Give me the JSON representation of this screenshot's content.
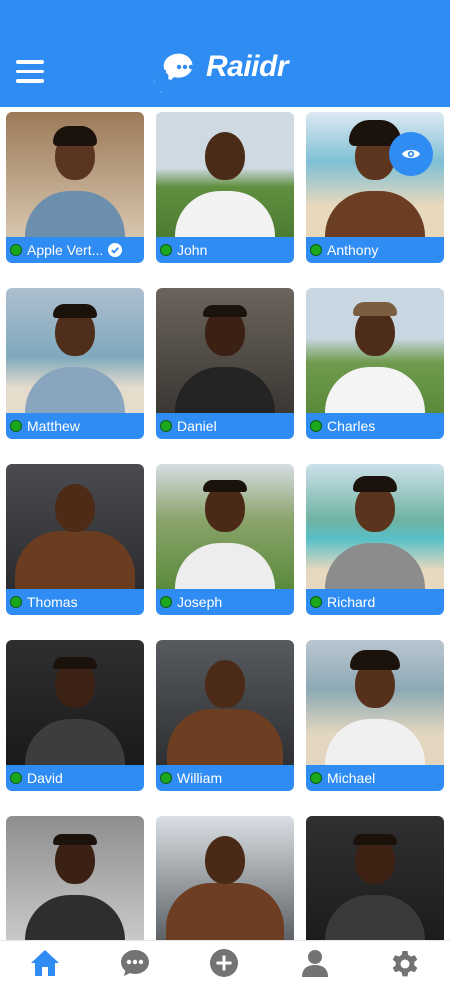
{
  "app": {
    "name": "Raiidr"
  },
  "header": {
    "logo_text": "Raiidr"
  },
  "colors": {
    "primary": "#2f8cf3",
    "online": "#1aa81f",
    "nav_active": "#2f8cf3",
    "nav_inactive": "#737373"
  },
  "profiles": [
    {
      "name": "Apple Vert...",
      "online": true,
      "verified": true
    },
    {
      "name": "John",
      "online": true
    },
    {
      "name": "Anthony",
      "online": true
    },
    {
      "name": "Matthew",
      "online": true
    },
    {
      "name": "Daniel",
      "online": true
    },
    {
      "name": "Charles",
      "online": true
    },
    {
      "name": "Thomas",
      "online": true
    },
    {
      "name": "Joseph",
      "online": true
    },
    {
      "name": "Richard",
      "online": true
    },
    {
      "name": "David",
      "online": true
    },
    {
      "name": "William",
      "online": true
    },
    {
      "name": "Michael",
      "online": true
    },
    {
      "name": "",
      "online": true
    },
    {
      "name": "",
      "online": true
    },
    {
      "name": "",
      "online": true
    }
  ],
  "overlay": {
    "icon": "eye-icon"
  },
  "bottom_nav": [
    {
      "icon": "home-icon",
      "active": true
    },
    {
      "icon": "chat-icon",
      "active": false
    },
    {
      "icon": "add-icon",
      "active": false
    },
    {
      "icon": "profile-icon",
      "active": false
    },
    {
      "icon": "settings-icon",
      "active": false
    }
  ]
}
